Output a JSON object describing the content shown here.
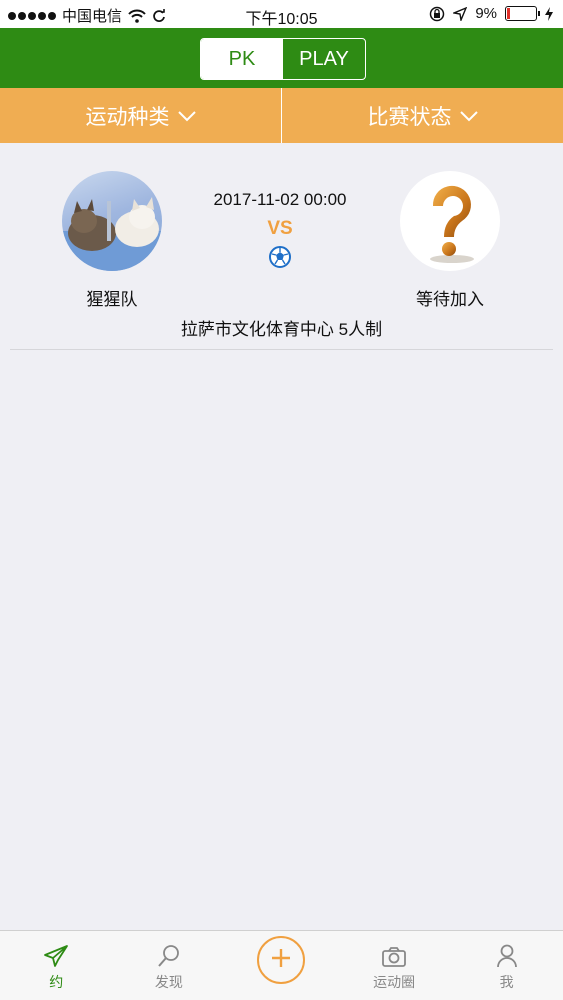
{
  "status_bar": {
    "carrier": "中国电信",
    "time": "下午10:05",
    "battery": "9%"
  },
  "header": {
    "tabs": [
      {
        "label": "PK",
        "active": true
      },
      {
        "label": "PLAY",
        "active": false
      }
    ]
  },
  "filters": [
    {
      "label": "运动种类"
    },
    {
      "label": "比赛状态"
    }
  ],
  "match": {
    "datetime": "2017-11-02 00:00",
    "vs": "VS",
    "home_team": "猩猩队",
    "away_team": "等待加入",
    "venue": "拉萨市文化体育中心 5人制",
    "sport_icon": "soccer-ball-icon"
  },
  "bottom_nav": [
    {
      "label": "约",
      "icon": "paper-plane-icon",
      "active": true
    },
    {
      "label": "发现",
      "icon": "magnifier-icon",
      "active": false
    },
    {
      "label": "",
      "icon": "plus-icon",
      "active": false
    },
    {
      "label": "运动圈",
      "icon": "camera-icon",
      "active": false
    },
    {
      "label": "我",
      "icon": "person-icon",
      "active": false
    }
  ],
  "colors": {
    "header_green": "#2e8b14",
    "filter_orange": "#f0ad52",
    "vs_orange": "#f0a040",
    "background": "#efeff4"
  }
}
